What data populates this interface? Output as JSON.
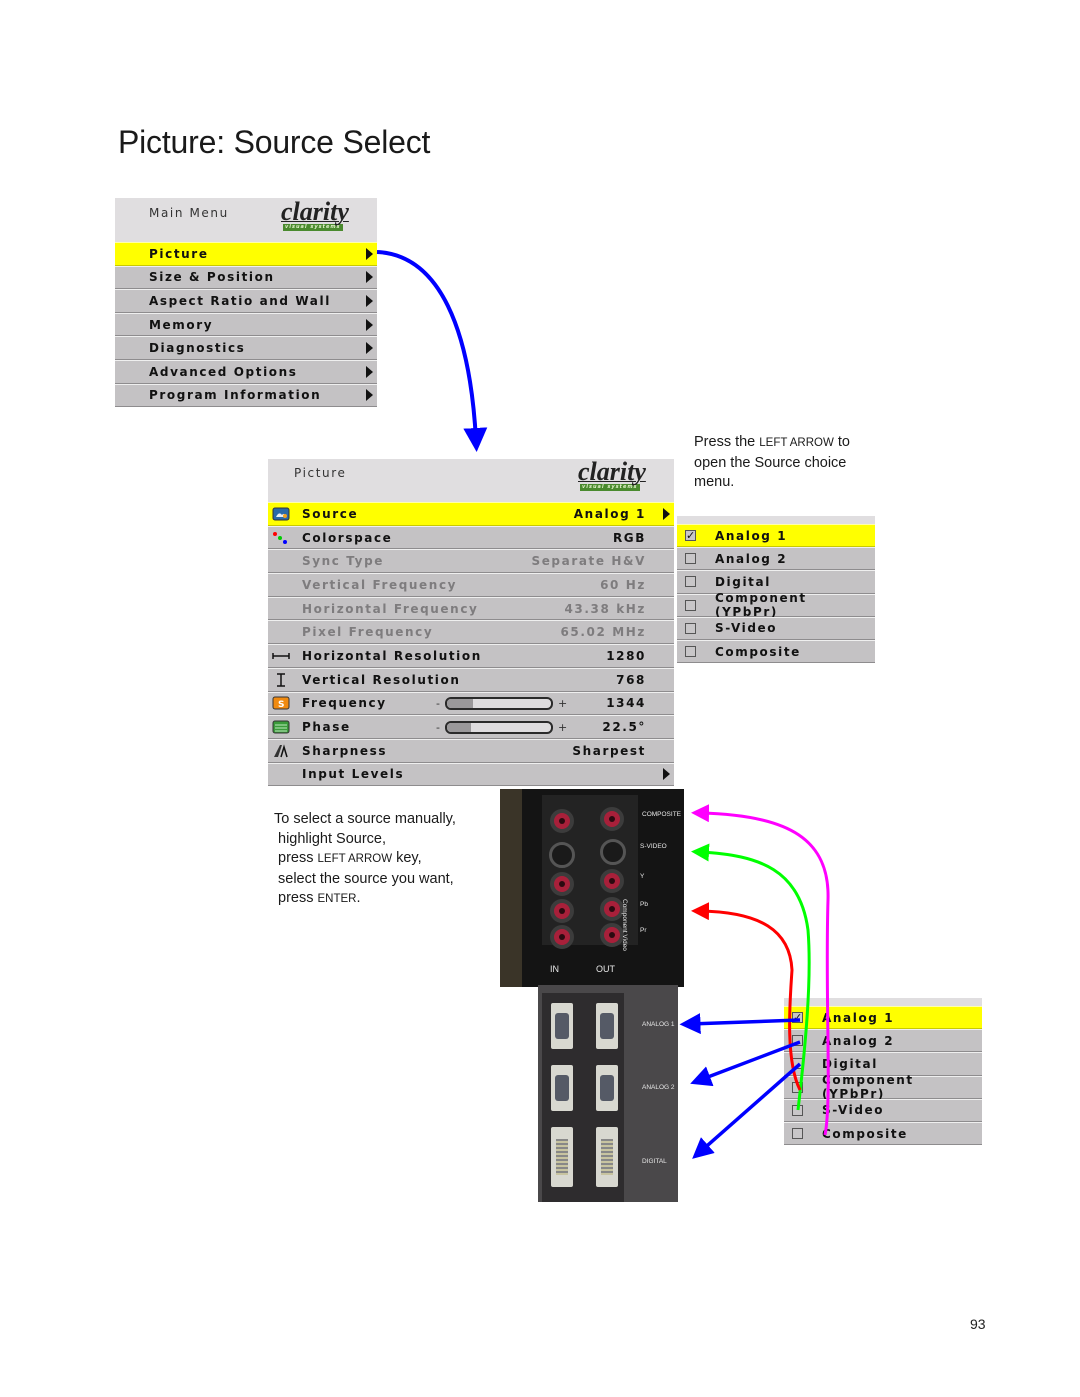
{
  "page": {
    "title": "Picture: Source Select",
    "page_number": "93"
  },
  "main_menu": {
    "title": "Main Menu",
    "logo": {
      "word": "clarity",
      "tagline": "visual systems"
    },
    "items": [
      {
        "label": "Picture",
        "selected": true,
        "submenu_icon": "triangle-right-icon"
      },
      {
        "label": "Size & Position",
        "selected": false,
        "submenu_icon": "triangle-right-icon"
      },
      {
        "label": "Aspect Ratio and Wall",
        "selected": false,
        "submenu_icon": "triangle-right-icon"
      },
      {
        "label": "Memory",
        "selected": false,
        "submenu_icon": "triangle-right-icon"
      },
      {
        "label": "Diagnostics",
        "selected": false,
        "submenu_icon": "triangle-right-icon"
      },
      {
        "label": "Advanced Options",
        "selected": false,
        "submenu_icon": "triangle-right-icon"
      },
      {
        "label": "Program Information",
        "selected": false,
        "submenu_icon": "triangle-right-icon"
      }
    ]
  },
  "picture_menu": {
    "title": "Picture",
    "logo": {
      "word": "clarity",
      "tagline": "visual systems"
    },
    "items": [
      {
        "label": "Source",
        "value": "Analog 1",
        "icon": "source-icon",
        "selected": true,
        "dimmed": false
      },
      {
        "label": "Colorspace",
        "value": "RGB",
        "icon": "colorspace-dots-icon",
        "selected": false,
        "dimmed": false
      },
      {
        "label": "Sync Type",
        "value": "Separate H&V",
        "icon": "",
        "selected": false,
        "dimmed": true
      },
      {
        "label": "Vertical Frequency",
        "value": "60 Hz",
        "icon": "",
        "selected": false,
        "dimmed": true
      },
      {
        "label": "Horizontal Frequency",
        "value": "43.38 kHz",
        "icon": "",
        "selected": false,
        "dimmed": true
      },
      {
        "label": "Pixel Frequency",
        "value": "65.02 MHz",
        "icon": "",
        "selected": false,
        "dimmed": true
      },
      {
        "label": "Horizontal Resolution",
        "value": "1280",
        "icon": "horizontal-resolution-icon",
        "selected": false,
        "dimmed": false
      },
      {
        "label": "Vertical Resolution",
        "value": "768",
        "icon": "vertical-resolution-icon",
        "selected": false,
        "dimmed": false
      },
      {
        "label": "Frequency",
        "value": "1344",
        "icon": "frequency-icon",
        "selected": false,
        "dimmed": false,
        "slider": {
          "minus": "-",
          "plus": "+",
          "level_percent": 25
        }
      },
      {
        "label": "Phase",
        "value": "22.5°",
        "icon": "phase-icon",
        "selected": false,
        "dimmed": false,
        "slider": {
          "minus": "-",
          "plus": "+",
          "level_percent": 23
        }
      },
      {
        "label": "Sharpness",
        "value": "Sharpest",
        "icon": "sharpness-icon",
        "selected": false,
        "dimmed": false
      },
      {
        "label": "Input Levels",
        "value": "",
        "icon": "",
        "selected": false,
        "dimmed": false,
        "submenu": true
      }
    ]
  },
  "source_choices": {
    "items": [
      {
        "label": "Analog 1",
        "checked": true,
        "selected": true
      },
      {
        "label": "Analog 2",
        "checked": false,
        "selected": false
      },
      {
        "label": "Digital",
        "checked": false,
        "selected": false
      },
      {
        "label": "Component (YPbPr)",
        "checked": false,
        "selected": false
      },
      {
        "label": "S-Video",
        "checked": false,
        "selected": false
      },
      {
        "label": "Composite",
        "checked": false,
        "selected": false
      }
    ],
    "check_glyph": "✓"
  },
  "captions": {
    "left_arrow": [
      "Press the ",
      "LEFT ARROW",
      " to",
      "open the Source choice",
      "menu."
    ],
    "select_steps": {
      "l1": "To select a source manually,",
      "l2": "highlight Source,",
      "l3a": "press ",
      "l3b": "LEFT ARROW",
      "l3c": " key,",
      "l4": "select the source you want,",
      "l5a": "press ",
      "l5b": "ENTER",
      "l5c": "."
    }
  },
  "photo_top": {
    "labels": {
      "composite": "COMPOSITE",
      "svideo": "S-VIDEO",
      "y": "Y",
      "pb": "Pb",
      "pr": "Pr",
      "component": "Component Video",
      "in": "IN",
      "out": "OUT"
    }
  },
  "photo_bottom": {
    "labels": {
      "analog1": "ANALOG 1",
      "analog2": "ANALOG 2",
      "digital": "DIGITAL"
    }
  },
  "colors": {
    "highlight": "#ffff00",
    "menu_bg": "#c4c2c4",
    "arrow_blue": "#0000ff",
    "arrow_magenta": "#ff00ff",
    "arrow_green": "#00ff00",
    "arrow_red": "#ff0000"
  }
}
